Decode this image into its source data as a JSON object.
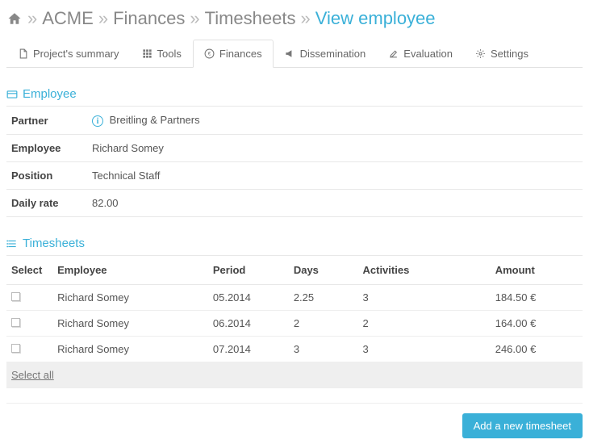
{
  "breadcrumb": {
    "home": "Home",
    "items": [
      "ACME",
      "Finances",
      "Timesheets"
    ],
    "current": "View employee",
    "sep": "»"
  },
  "tabs": [
    {
      "label": "Project's summary",
      "icon": "file"
    },
    {
      "label": "Tools",
      "icon": "grid"
    },
    {
      "label": "Finances",
      "icon": "euro",
      "active": true
    },
    {
      "label": "Dissemination",
      "icon": "bullhorn"
    },
    {
      "label": "Evaluation",
      "icon": "edit"
    },
    {
      "label": "Settings",
      "icon": "gear"
    }
  ],
  "employee_section": {
    "title": "Employee",
    "rows": {
      "partner_k": "Partner",
      "partner_v": "Breitling & Partners",
      "employee_k": "Employee",
      "employee_v": "Richard Somey",
      "position_k": "Position",
      "position_v": "Technical Staff",
      "rate_k": "Daily rate",
      "rate_v": "82.00"
    }
  },
  "timesheets_section": {
    "title": "Timesheets",
    "headers": {
      "select": "Select",
      "employee": "Employee",
      "period": "Period",
      "days": "Days",
      "activities": "Activities",
      "amount": "Amount"
    },
    "rows": [
      {
        "employee": "Richard Somey",
        "period": "05.2014",
        "days": "2.25",
        "activities": "3",
        "amount": "184.50 €"
      },
      {
        "employee": "Richard Somey",
        "period": "06.2014",
        "days": "2",
        "activities": "2",
        "amount": "164.00 €"
      },
      {
        "employee": "Richard Somey",
        "period": "07.2014",
        "days": "3",
        "activities": "3",
        "amount": "246.00 €"
      }
    ],
    "select_all": "Select all"
  },
  "actions": {
    "add_timesheet": "Add a new timesheet"
  }
}
